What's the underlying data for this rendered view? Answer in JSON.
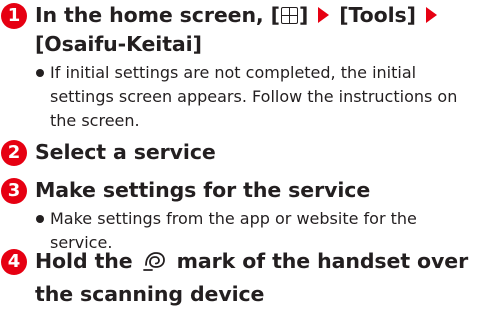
{
  "steps": [
    {
      "number": "1",
      "title_parts": {
        "prefix": "In the home screen, [",
        "suffix": "]",
        "tools": "[Tools]",
        "app": "[Osaifu-Keitai]"
      },
      "icon_key": "grid-key-icon",
      "notes": [
        "If initial settings are not completed, the initial settings screen appears. Follow the instructions on the screen."
      ]
    },
    {
      "number": "2",
      "title": "Select a service"
    },
    {
      "number": "3",
      "title": "Make settings for the service",
      "notes": [
        "Make settings from the app or website for the service."
      ]
    },
    {
      "number": "4",
      "title_parts": {
        "before": "Hold the",
        "after_line1": "mark of the handset over",
        "line2": "the scanning device"
      },
      "icon_mark": "felica-mark-icon"
    }
  ],
  "colors": {
    "accent": "#e60012",
    "text": "#231f20"
  }
}
